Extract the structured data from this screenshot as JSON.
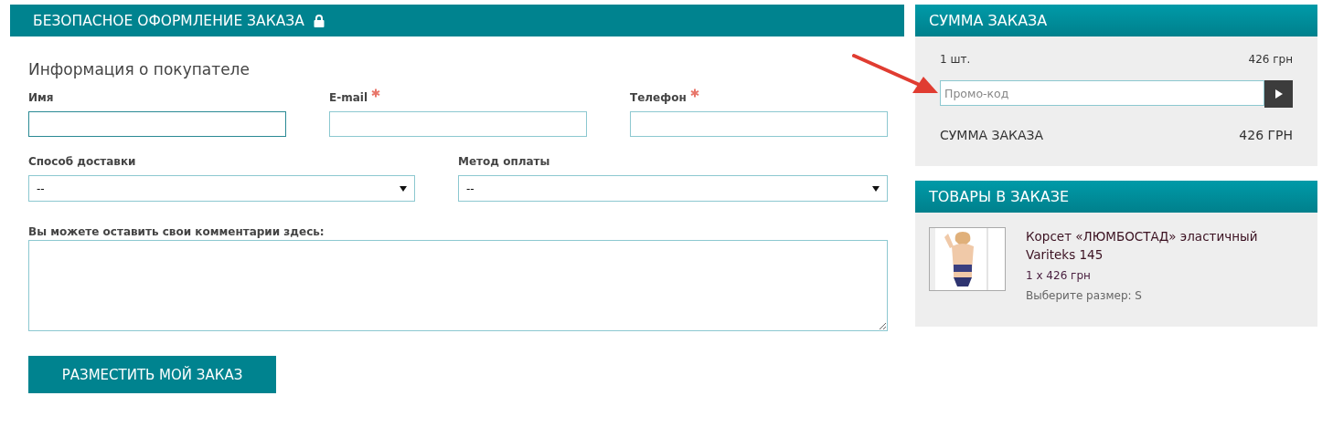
{
  "checkout": {
    "title": "БЕЗОПАСНОЕ ОФОРМЛЕНИЕ ЗАКАЗА",
    "section_title": "Информация о покупателе",
    "fields": [
      {
        "label": "Имя",
        "required": false,
        "focused": true
      },
      {
        "label": "E-mail",
        "required": true,
        "focused": false
      },
      {
        "label": "Телефон",
        "required": true,
        "focused": false
      }
    ],
    "selects": [
      {
        "label": "Способ доставки",
        "value": "--"
      },
      {
        "label": "Метод оплаты",
        "value": "--"
      }
    ],
    "comment_label": "Вы можете оставить свои комментарии здесь:",
    "submit": "РАЗМЕСТИТЬ МОЙ ЗАКАЗ"
  },
  "summary": {
    "title": "СУММА ЗАКАЗА",
    "quantity": "1 шт.",
    "subtotal": "426 грн",
    "promo_placeholder": "Промо-код",
    "total_label": "СУММА ЗАКАЗА",
    "total": "426 ГРН"
  },
  "items_panel": {
    "title": "ТОВАРЫ В ЗАКАЗЕ",
    "items": [
      {
        "name": "Корсет «ЛЮМБОСТАД» эластичный Variteks 145",
        "price": "1 x 426 грн",
        "size": "Выберите размер: S"
      }
    ]
  }
}
